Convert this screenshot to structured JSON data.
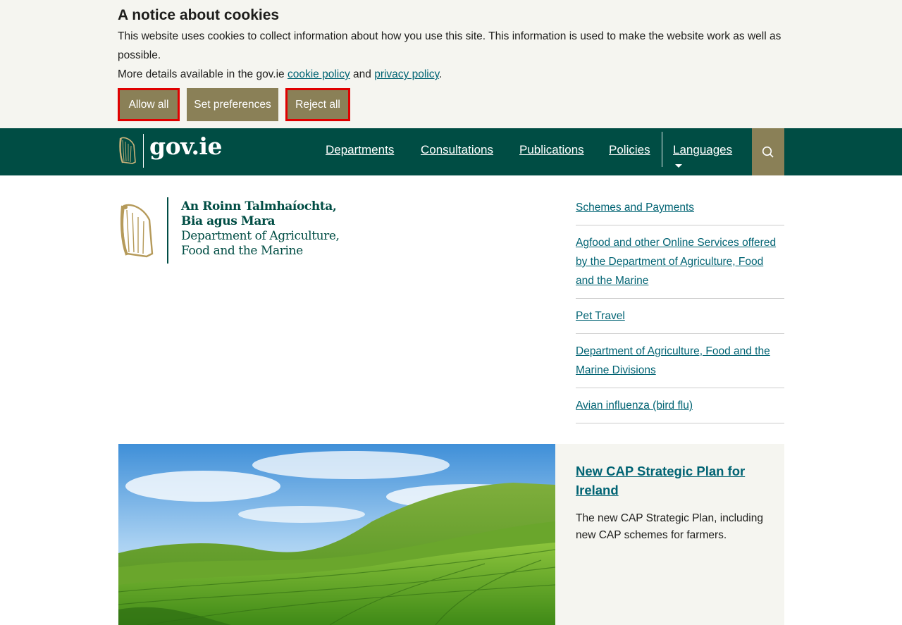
{
  "cookie_banner": {
    "title": "A notice about cookies",
    "text": "This website uses cookies to collect information about how you use this site. This information is used to make the website work as well as possible.",
    "more_prefix": "More details available in the gov.ie ",
    "cookie_policy_link": "cookie policy",
    "and_text": " and ",
    "privacy_policy_link": "privacy policy",
    "period": ".",
    "buttons": {
      "allow_all": "Allow all",
      "set_preferences": "Set preferences",
      "reject_all": "Reject all"
    }
  },
  "header": {
    "logo_text": "gov.ie",
    "nav": {
      "departments": "Departments",
      "consultations": "Consultations",
      "publications": "Publications",
      "policies": "Policies",
      "languages": "Languages"
    },
    "search_icon": "search-icon"
  },
  "department": {
    "line1": "An Roinn Talmhaíochta,",
    "line2": "Bia agus Mara",
    "line3": "Department of Agriculture,",
    "line4": "Food and the Marine"
  },
  "side_links": [
    "Schemes and Payments",
    "Agfood and other Online Services offered by the Department of Agriculture, Food and the Marine",
    "Pet Travel",
    "Department of Agriculture, Food and the Marine Divisions",
    "Avian influenza (bird flu)"
  ],
  "feature": {
    "title": "New CAP Strategic Plan for Ireland",
    "description": "The new CAP Strategic Plan, including new CAP schemes for farmers."
  },
  "colors": {
    "header_bg": "#004d44",
    "accent_button": "#8a8057",
    "link": "#006373",
    "banner_bg": "#f5f5f0",
    "highlight_outline": "#e00000"
  }
}
